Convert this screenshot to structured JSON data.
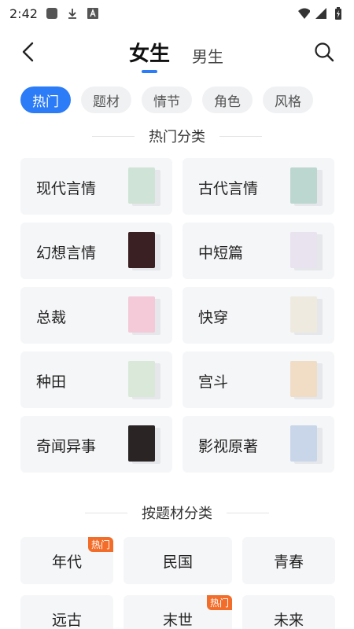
{
  "status_bar": {
    "time": "2:42"
  },
  "header": {
    "tabs": [
      {
        "label": "女生",
        "active": true
      },
      {
        "label": "男生",
        "active": false
      }
    ],
    "accent_color": "#2b7cf6"
  },
  "chips": [
    {
      "label": "热门",
      "active": true
    },
    {
      "label": "题材"
    },
    {
      "label": "情节"
    },
    {
      "label": "角色"
    },
    {
      "label": "风格"
    }
  ],
  "hot_section": {
    "title": "热门分类",
    "items": [
      {
        "label": "现代言情",
        "cover_color": "#cfe3d6"
      },
      {
        "label": "古代言情",
        "cover_color": "#bcd7cf"
      },
      {
        "label": "幻想言情",
        "cover_color": "#3a1f23"
      },
      {
        "label": "中短篇",
        "cover_color": "#e8e3ef"
      },
      {
        "label": "总裁",
        "cover_color": "#f4c9d8"
      },
      {
        "label": "快穿",
        "cover_color": "#efeae0"
      },
      {
        "label": "种田",
        "cover_color": "#d9e8d9"
      },
      {
        "label": "宫斗",
        "cover_color": "#f1dcc6"
      },
      {
        "label": "奇闻异事",
        "cover_color": "#2a2425"
      },
      {
        "label": "影视原著",
        "cover_color": "#c9d6ea"
      }
    ]
  },
  "theme_section": {
    "title": "按题材分类",
    "badge_text": "热门",
    "items": [
      {
        "label": "年代",
        "hot": true
      },
      {
        "label": "民国",
        "hot": false
      },
      {
        "label": "青春",
        "hot": false
      },
      {
        "label": "远古",
        "hot": false
      },
      {
        "label": "末世",
        "hot": true
      },
      {
        "label": "未来",
        "hot": false
      }
    ]
  }
}
